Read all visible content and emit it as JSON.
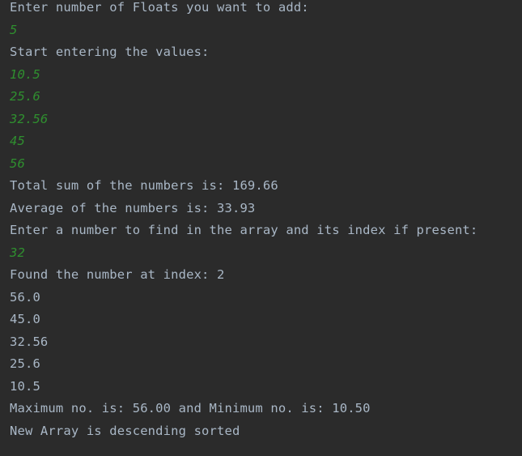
{
  "console": {
    "lines": [
      {
        "text": "Enter number of Floats you want to add:",
        "kind": "output"
      },
      {
        "text": "5",
        "kind": "input"
      },
      {
        "text": "Start entering the values:",
        "kind": "output"
      },
      {
        "text": "10.5",
        "kind": "input"
      },
      {
        "text": "25.6",
        "kind": "input"
      },
      {
        "text": "32.56",
        "kind": "input"
      },
      {
        "text": "45",
        "kind": "input"
      },
      {
        "text": "56",
        "kind": "input"
      },
      {
        "text": "Total sum of the numbers is: 169.66",
        "kind": "output"
      },
      {
        "text": "Average of the numbers is: 33.93",
        "kind": "output"
      },
      {
        "text": "Enter a number to find in the array and its index if present:",
        "kind": "output"
      },
      {
        "text": "32",
        "kind": "input"
      },
      {
        "text": "Found the number at index: 2",
        "kind": "output"
      },
      {
        "text": "56.0",
        "kind": "output"
      },
      {
        "text": "45.0",
        "kind": "output"
      },
      {
        "text": "32.56",
        "kind": "output"
      },
      {
        "text": "25.6",
        "kind": "output"
      },
      {
        "text": "10.5",
        "kind": "output"
      },
      {
        "text": "Maximum no. is: 56.00 and Minimum no. is: 10.50",
        "kind": "output"
      },
      {
        "text": "New Array is descending sorted",
        "kind": "output"
      }
    ]
  },
  "colors": {
    "background": "#2b2b2b",
    "output_text": "#a9b7c6",
    "input_text": "#2f8f2f"
  }
}
